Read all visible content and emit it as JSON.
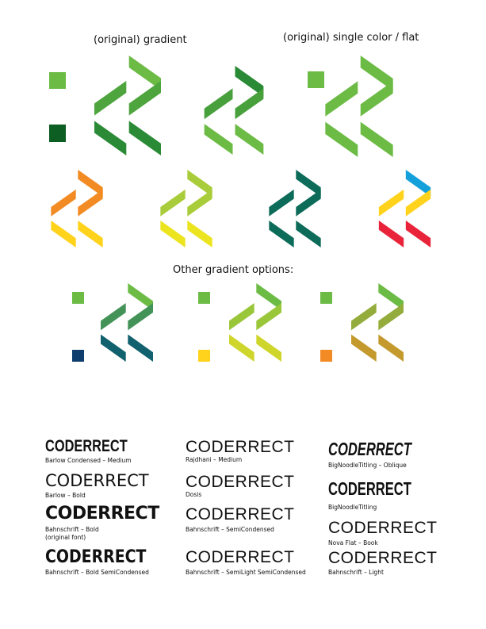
{
  "headings": {
    "gradient": "(original) gradient",
    "flat": "(original) single color / flat",
    "other": "Other gradient options:"
  },
  "logo_text": "CODERRECT",
  "fonts": [
    {
      "name": "Barlow Condensed – Medium"
    },
    {
      "name": "Barlow – Bold"
    },
    {
      "name": "Bahnschrift – Bold",
      "note": "(original font)"
    },
    {
      "name": "Bahnschrift – Bold SemiCondensed"
    },
    {
      "name": "Rajdhani – Medium"
    },
    {
      "name": "Dosis"
    },
    {
      "name": "Bahnschrift – SemiCondensed"
    },
    {
      "name": "Bahnschrift – SemiLight SemiCondensed"
    },
    {
      "name": "BigNoodleTitling – Oblique"
    },
    {
      "name": "BigNoodleTitling"
    },
    {
      "name": "Nova Flat – Book"
    },
    {
      "name": "Bahnschrift – Light"
    }
  ],
  "colors": {
    "light_green": "#6cbb45",
    "dark_green": "#2a8a35",
    "darkest_green": "#0d5e22",
    "teal": "#0c6b59",
    "orange": "#f28b24",
    "yellow": "#ffd21c",
    "lime": "#a9cd3a",
    "lemon": "#ece41e",
    "red": "#e9243a",
    "blue": "#14a0da",
    "navy": "#0f3d6e",
    "ochre": "#b8a032"
  },
  "logos": [
    {
      "style": "gradient",
      "top": "#6cbb45",
      "bottom": "#2a8a35"
    },
    {
      "style": "gradient",
      "top": "#2a8a35",
      "bottom": "#6cbb45"
    },
    {
      "style": "flat",
      "top": "#6cbb45",
      "bottom": "#6cbb45"
    },
    {
      "style": "duo",
      "top": "#f28b24",
      "bottom": "#ffd21c"
    },
    {
      "style": "duo",
      "top": "#a9cd3a",
      "bottom": "#ece41e"
    },
    {
      "style": "flat",
      "top": "#0c6b59",
      "bottom": "#0c6b59"
    },
    {
      "style": "tri",
      "top": "#14a0da",
      "mid": "#ffd21c",
      "bottom": "#e9243a"
    },
    {
      "style": "gradient",
      "top": "#6cbb45",
      "bottom": "#11616f"
    },
    {
      "style": "gradient",
      "top": "#6cbb45",
      "bottom": "#cfd62b"
    },
    {
      "style": "gradient",
      "top": "#6cbb45",
      "bottom": "#c49a2e"
    }
  ]
}
